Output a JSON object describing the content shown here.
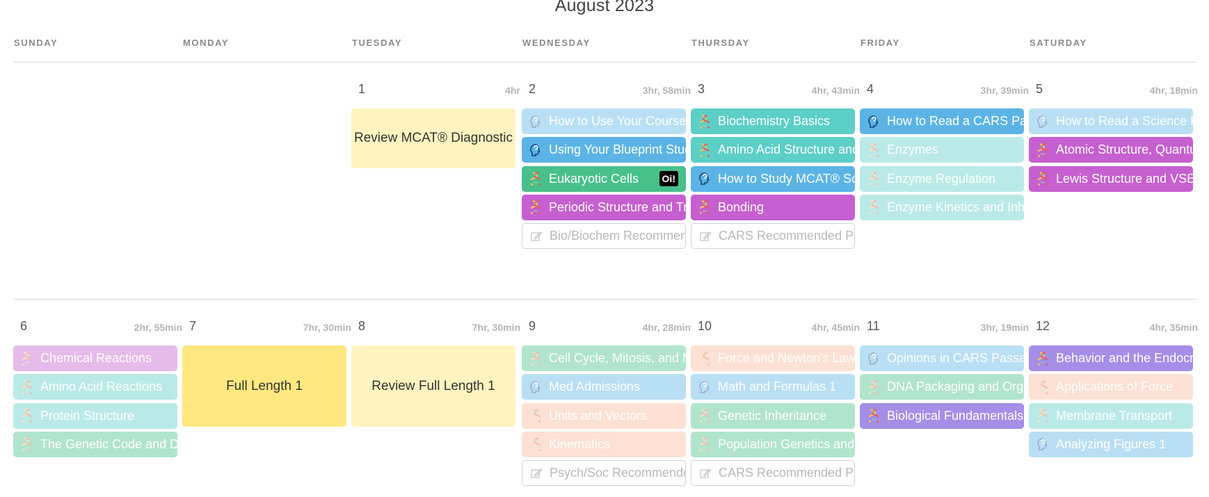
{
  "title": "August 2023",
  "weekdays": [
    "SUNDAY",
    "MONDAY",
    "TUESDAY",
    "WEDNESDAY",
    "THURSDAY",
    "FRIDAY",
    "SATURDAY"
  ],
  "colors": {
    "biology": "#48c08a",
    "biochem": "#5ccfc7",
    "chem": "#c65fcf",
    "cars": "#5bb4e5",
    "physics": "#fcb99a",
    "review": "#fff3c0",
    "fulllength": "#ffe880"
  },
  "weeks": [
    {
      "days": [
        {
          "num": "",
          "hours": "",
          "events": []
        },
        {
          "num": "",
          "hours": "",
          "events": []
        },
        {
          "num": "1",
          "hours": "4hr",
          "block": {
            "label": "Review MCAT® Diagnostic",
            "style": "review"
          }
        },
        {
          "num": "2",
          "hours": "3hr, 58min",
          "events": [
            {
              "label": "How to Use Your Course",
              "type": "cars",
              "icon": "head-icon",
              "faded": true
            },
            {
              "label": "Using Your Blueprint Study",
              "type": "cars",
              "icon": "head-icon",
              "faded": false
            },
            {
              "label": "Eukaryotic Cells",
              "type": "biology",
              "icon": "dna-icon",
              "faded": false,
              "badge": "Oi!"
            },
            {
              "label": "Periodic Structure and Trends",
              "type": "chem",
              "icon": "dna-icon",
              "faded": false
            },
            {
              "label": "Bio/Biochem Recommended",
              "type": "rec",
              "icon": "edit-icon",
              "faded": false
            }
          ]
        },
        {
          "num": "3",
          "hours": "4hr, 43min",
          "events": [
            {
              "label": "Biochemistry Basics",
              "type": "biochem",
              "icon": "dna-icon",
              "faded": false
            },
            {
              "label": "Amino Acid Structure and",
              "type": "biochem",
              "icon": "dna-icon",
              "faded": false
            },
            {
              "label": "How to Study MCAT® Science",
              "type": "cars",
              "icon": "head-icon",
              "faded": false
            },
            {
              "label": "Bonding",
              "type": "chem",
              "icon": "dna-icon",
              "faded": false
            },
            {
              "label": "CARS Recommended Practice",
              "type": "rec",
              "icon": "edit-icon",
              "faded": false
            }
          ]
        },
        {
          "num": "4",
          "hours": "3hr, 39min",
          "events": [
            {
              "label": "How to Read a CARS Passage",
              "type": "cars",
              "icon": "head-icon",
              "faded": false
            },
            {
              "label": "Enzymes",
              "type": "biochem",
              "icon": "dna-icon",
              "faded": true
            },
            {
              "label": "Enzyme Regulation",
              "type": "biochem",
              "icon": "dna-icon",
              "faded": true
            },
            {
              "label": "Enzyme Kinetics and Inhibition",
              "type": "biochem",
              "icon": "dna-icon",
              "faded": true
            }
          ]
        },
        {
          "num": "5",
          "hours": "4hr, 18min",
          "events": [
            {
              "label": "How to Read a Science Passage",
              "type": "cars",
              "icon": "head-icon",
              "faded": true
            },
            {
              "label": "Atomic Structure, Quantum",
              "type": "chem",
              "icon": "dna-icon",
              "faded": false
            },
            {
              "label": "Lewis Structure and VSEPR",
              "type": "chem",
              "icon": "dna-icon",
              "faded": false
            }
          ]
        }
      ]
    },
    {
      "days": [
        {
          "num": "6",
          "hours": "2hr, 55min",
          "events": [
            {
              "label": "Chemical Reactions",
              "type": "chem",
              "icon": "dna-icon",
              "faded": true
            },
            {
              "label": "Amino Acid Reactions",
              "type": "biochem",
              "icon": "dna-icon",
              "faded": true
            },
            {
              "label": "Protein Structure",
              "type": "biochem",
              "icon": "dna-icon",
              "faded": true
            },
            {
              "label": "The Genetic Code and DNA",
              "type": "biology",
              "icon": "dna-icon",
              "faded": true
            }
          ]
        },
        {
          "num": "7",
          "hours": "7hr, 30min",
          "block": {
            "label": "Full Length 1",
            "style": "fulllength"
          }
        },
        {
          "num": "8",
          "hours": "7hr, 30min",
          "block": {
            "label": "Review Full Length 1",
            "style": "review"
          }
        },
        {
          "num": "9",
          "hours": "4hr, 28min",
          "events": [
            {
              "label": "Cell Cycle, Mitosis, and Meiosis",
              "type": "biology",
              "icon": "dna-icon",
              "faded": true
            },
            {
              "label": "Med Admissions",
              "type": "cars",
              "icon": "head-icon",
              "faded": true
            },
            {
              "label": "Units and Vectors",
              "type": "physics",
              "icon": "dna-icon",
              "faded": true
            },
            {
              "label": "Kinematics",
              "type": "physics",
              "icon": "dna-icon",
              "faded": true
            },
            {
              "label": "Psych/Soc Recommended",
              "type": "rec",
              "icon": "edit-icon",
              "faded": false
            }
          ]
        },
        {
          "num": "10",
          "hours": "4hr, 45min",
          "events": [
            {
              "label": "Force and Newton's Laws",
              "type": "physics",
              "icon": "dna-icon",
              "faded": true
            },
            {
              "label": "Math and Formulas 1",
              "type": "cars",
              "icon": "head-icon",
              "faded": true
            },
            {
              "label": "Genetic Inheritance",
              "type": "biology",
              "icon": "dna-icon",
              "faded": true
            },
            {
              "label": "Population Genetics and",
              "type": "biology",
              "icon": "dna-icon",
              "faded": true
            },
            {
              "label": "CARS Recommended Practice",
              "type": "rec",
              "icon": "edit-icon",
              "faded": false
            }
          ]
        },
        {
          "num": "11",
          "hours": "3hr, 19min",
          "events": [
            {
              "label": "Opinions in CARS Passages",
              "type": "cars",
              "icon": "head-icon",
              "faded": true
            },
            {
              "label": "DNA Packaging and Organization",
              "type": "biology",
              "icon": "dna-icon",
              "faded": true
            },
            {
              "label": "Biological Fundamentals",
              "type": "chem2",
              "icon": "dna-icon",
              "faded": false
            }
          ]
        },
        {
          "num": "12",
          "hours": "4hr, 35min",
          "events": [
            {
              "label": "Behavior and the Endocrine",
              "type": "chem2",
              "icon": "dna-icon",
              "faded": false
            },
            {
              "label": "Applications of Force",
              "type": "physics",
              "icon": "dna-icon",
              "faded": true
            },
            {
              "label": "Membrane Transport",
              "type": "biochem",
              "icon": "dna-icon",
              "faded": true
            },
            {
              "label": "Analyzing Figures 1",
              "type": "cars",
              "icon": "head-icon",
              "faded": true
            }
          ]
        }
      ]
    }
  ]
}
